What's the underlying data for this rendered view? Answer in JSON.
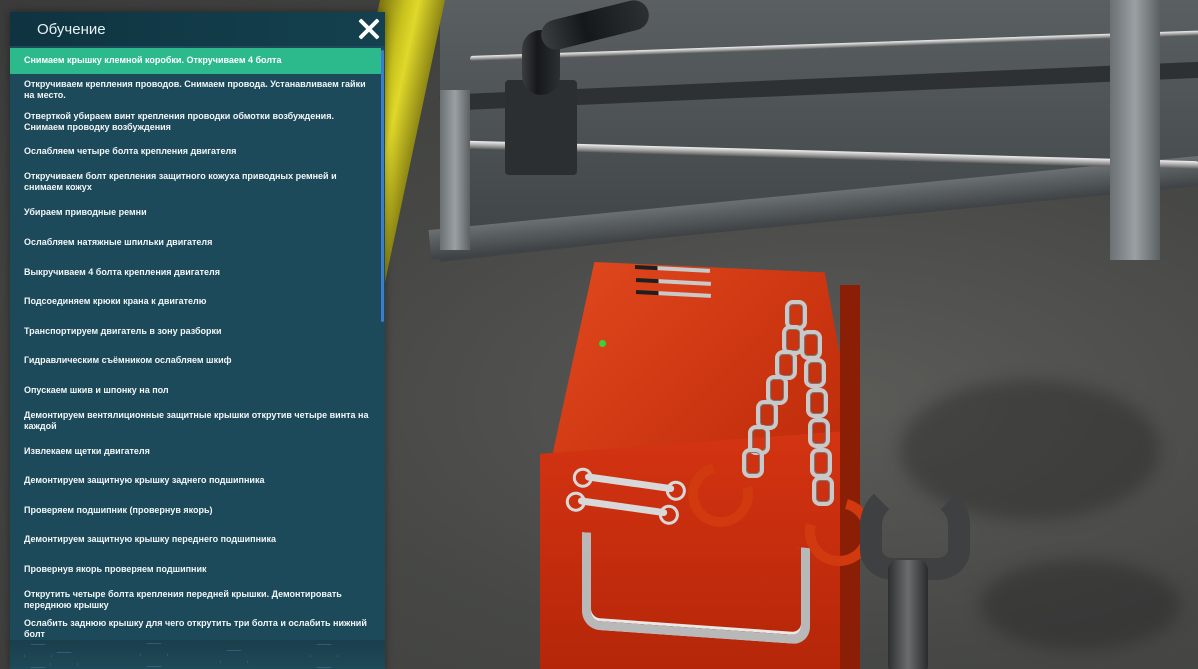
{
  "panel": {
    "title": "Обучение",
    "close_icon": "close-icon",
    "steps": [
      {
        "label": "Снимаем крышку клемной коробки. Откручиваем 4 болта",
        "active": true
      },
      {
        "label": "Откручиваем крепления проводов. Снимаем провода. Устанавливаем гайки на место.",
        "active": false
      },
      {
        "label": "Отверткой убираем винт крепления проводки обмотки возбуждения. Снимаем проводку возбуждения",
        "active": false
      },
      {
        "label": "Ослабляем четыре болта крепления двигателя",
        "active": false
      },
      {
        "label": "Откручиваем болт крепления защитного кожуха приводных ремней и снимаем кожух",
        "active": false
      },
      {
        "label": "Убираем приводные ремни",
        "active": false
      },
      {
        "label": "Ослабляем натяжные шпильки двигателя",
        "active": false
      },
      {
        "label": "Выкручиваем 4 болта крепления двигателя",
        "active": false
      },
      {
        "label": "Подсоединяем крюки крана к двигателю",
        "active": false
      },
      {
        "label": "Транспортируем двигатель в зону разборки",
        "active": false
      },
      {
        "label": "Гидравлическим съёмником  ослабляем шкиф",
        "active": false
      },
      {
        "label": "Опускаем шкив и шпонку на пол",
        "active": false
      },
      {
        "label": "Демонтируем вентялиционные защитные крышки открутив четыре винта на каждой",
        "active": false
      },
      {
        "label": "Извлекаем щетки двигателя",
        "active": false
      },
      {
        "label": "Демонтируем защитную крышку заднего подшипника",
        "active": false
      },
      {
        "label": "Проверяем подшипник (провернув якорь)",
        "active": false
      },
      {
        "label": "Демонтируем защитную крышку переднего подшипника",
        "active": false
      },
      {
        "label": "Провернув якорь проверяем подшипник",
        "active": false
      },
      {
        "label": "Открутить четыре болта крепления передней крышки. Демонтировать переднюю крышку",
        "active": false
      },
      {
        "label": "Ослабить заднюю крышку для чего  открутить три болта и ослабить нижний болт",
        "active": false
      }
    ]
  },
  "colors": {
    "panel_bg": "#1d4a5a",
    "active_step": "#2cb98c",
    "scrollbar": "#3d7dcf"
  }
}
